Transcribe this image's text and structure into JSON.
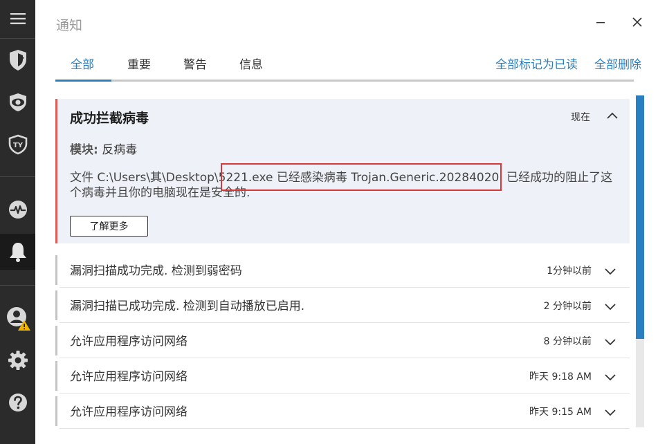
{
  "window": {
    "title": "通知",
    "minimize_icon": "minimize-icon",
    "close_icon": "close-icon"
  },
  "sidebar": {
    "items": [
      {
        "name": "menu",
        "icon": "hamburger-menu-icon"
      },
      {
        "name": "protection",
        "icon": "shield-icon"
      },
      {
        "name": "privacy",
        "icon": "eye-icon"
      },
      {
        "name": "ty",
        "icon": "ty-badge-icon"
      },
      {
        "name": "activity",
        "icon": "pulse-icon"
      },
      {
        "name": "notifications",
        "icon": "bell-icon",
        "active": true
      },
      {
        "name": "account",
        "icon": "user-warning-icon"
      },
      {
        "name": "settings",
        "icon": "gear-icon"
      },
      {
        "name": "help",
        "icon": "help-icon"
      }
    ],
    "colors": {
      "background": "#2b2b2b",
      "active": "#1a1a1a",
      "icon": "#d8d8d8",
      "warning": "#f0b400"
    }
  },
  "tabs": [
    {
      "label": "全部",
      "active": true
    },
    {
      "label": "重要",
      "active": false
    },
    {
      "label": "警告",
      "active": false
    },
    {
      "label": "信息",
      "active": false
    }
  ],
  "actions": {
    "mark_all_read": "全部标记为已读",
    "delete_all": "全部删除"
  },
  "notifications": {
    "expanded": {
      "title": "成功拦截病毒",
      "time": "现在",
      "module_label": "模块:",
      "module_value": "反病毒",
      "body": "文件 C:\\Users\\其\\Desktop\\5221.exe 已经感染病毒 Trojan.Generic.20284020. 已经成功的阻止了这个病毒并且你的电脑现在是安全的.",
      "learn_more": "了解更多",
      "accent": "#e05a56"
    },
    "items": [
      {
        "title": "漏洞扫描成功完成. 检测到弱密码",
        "time": "1分钟以前"
      },
      {
        "title": "漏洞扫描已成功完成. 检测到自动播放已启用.",
        "time": "2 分钟以前"
      },
      {
        "title": "允许应用程序访问网络",
        "time": "8 分钟以前"
      },
      {
        "title": "允许应用程序访问网络",
        "time": "昨天 9:18 AM"
      },
      {
        "title": "允许应用程序访问网络",
        "time": "昨天 9:15 AM"
      }
    ]
  },
  "colors": {
    "accent": "#2a7fc1",
    "highlight_box": "#d9383a",
    "card_background": "#eef2f8"
  }
}
